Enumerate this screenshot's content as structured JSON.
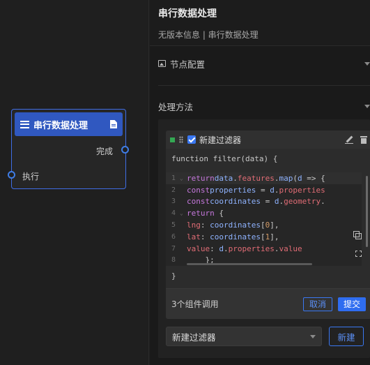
{
  "node": {
    "title": "串行数据处理",
    "output_label": "完成",
    "input_label": "执行"
  },
  "panel": {
    "title": "串行数据处理",
    "subtitle": "无版本信息 | 串行数据处理",
    "node_config_label": "节点配置",
    "process_method_label": "处理方法"
  },
  "filter": {
    "name": "新建过滤器",
    "signature": "function filter(data) {",
    "closing": "}",
    "line_numbers": [
      "1",
      "2",
      "3",
      "4",
      "5",
      "6",
      "7",
      "8"
    ],
    "component_count": "3个组件调用",
    "cancel_label": "取消",
    "submit_label": "提交"
  },
  "selector": {
    "value": "新建过滤器",
    "new_label": "新建"
  },
  "colors": {
    "accent": "#3a78f2",
    "node_header": "#3058c0",
    "status_green": "#34a853"
  }
}
